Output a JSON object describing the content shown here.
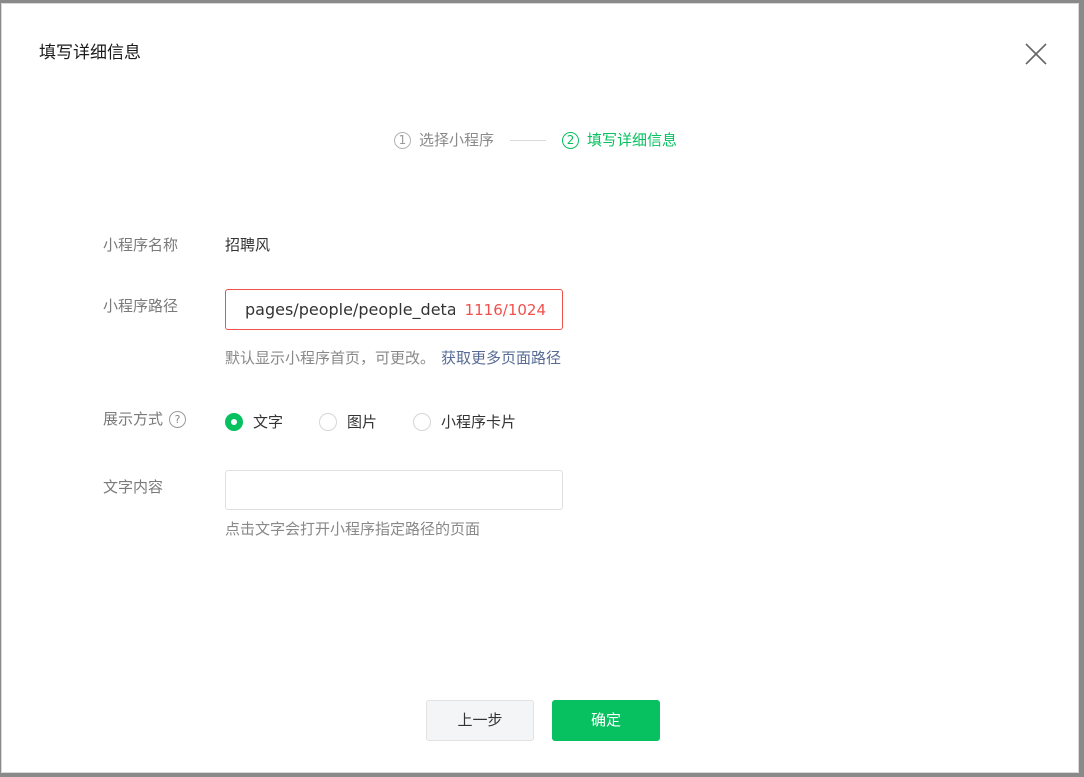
{
  "dialog": {
    "title": "填写详细信息"
  },
  "steps": [
    {
      "num": "1",
      "label": "选择小程序",
      "state": "inactive"
    },
    {
      "num": "2",
      "label": "填写详细信息",
      "state": "active"
    }
  ],
  "form": {
    "name": {
      "label": "小程序名称",
      "value": "招聘风"
    },
    "path": {
      "label": "小程序路径",
      "value": "pages/people/people_detail",
      "count": "1116/1024",
      "hint": "默认显示小程序首页，可更改。",
      "hint_link": "获取更多页面路径"
    },
    "display": {
      "label": "展示方式",
      "help_icon": "?",
      "options": [
        {
          "label": "文字",
          "checked": true
        },
        {
          "label": "图片",
          "checked": false
        },
        {
          "label": "小程序卡片",
          "checked": false
        }
      ]
    },
    "text": {
      "label": "文字内容",
      "value": "",
      "hint": "点击文字会打开小程序指定路径的页面"
    }
  },
  "buttons": {
    "prev": "上一步",
    "ok": "确定"
  },
  "colors": {
    "accent": "#07c160",
    "error": "#f0504c",
    "link": "#576b95"
  }
}
